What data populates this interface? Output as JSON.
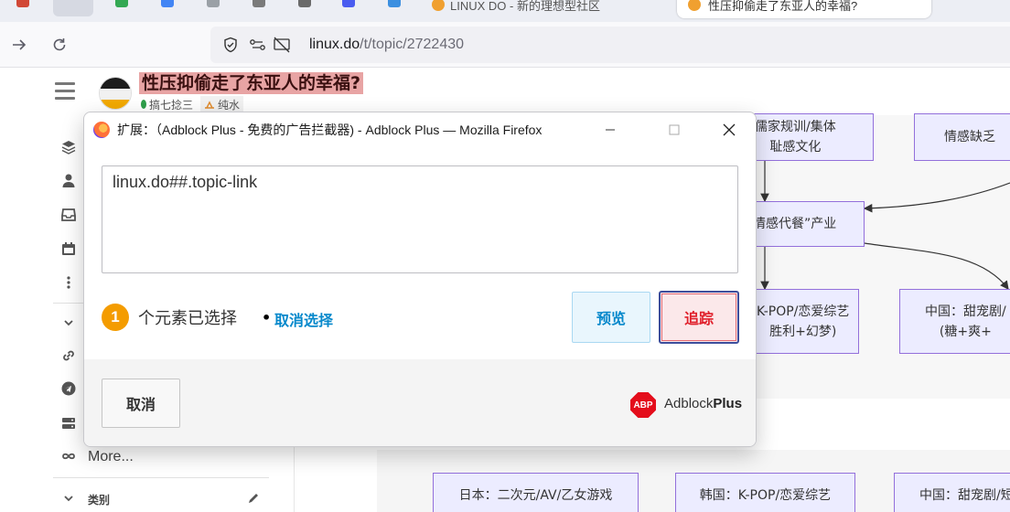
{
  "browser": {
    "tabs": [
      {
        "label": "LINUX DO - 新的理想型社区"
      },
      {
        "label": "性压抑偷走了东亚人的幸福?"
      }
    ],
    "url_host": "linux.do",
    "url_path": "/t/topic/2722430"
  },
  "page": {
    "topic_title": "性压抑偷走了东亚人的幸福?",
    "category": "搞七捻三",
    "tag": "纯水",
    "sidebar": {
      "more_label": "More...",
      "categories_label": "类别"
    },
    "flowchart_boxes": [
      {
        "text": "儒家规训/集体\n耻感文化"
      },
      {
        "text": "情感缺乏"
      },
      {
        "text": "情感代餐”产业"
      },
      {
        "text": "K-POP/恋爱综艺\n胜利+幻梦)"
      },
      {
        "text": "中国：甜宠剧/\n(糖+爽+"
      },
      {
        "text": "日本：二次元/AV/乙女游戏"
      },
      {
        "text": "韩国：K-POP/恋爱综艺"
      },
      {
        "text": "中国：甜宠剧/短"
      }
    ]
  },
  "dialog": {
    "title": "扩展：（Adblock Plus - 免费的广告拦截器) - Adblock Plus — Mozilla Firefox",
    "filter_text": "linux.do##.topic-link",
    "selected_count": "1",
    "selected_text": "个元素已选择",
    "separator": "•",
    "deselect_label": "取消选择",
    "preview_label": "预览",
    "track_label": "追踪",
    "cancel_label": "取消",
    "abp_badge": "ABP",
    "brand_light": "Adblock",
    "brand_bold": "Plus"
  },
  "colors": {
    "title_highlight": "#e8a4a4",
    "abp_red": "#e40d1b",
    "link_blue": "#0688cb",
    "badge_orange": "#f49c00"
  }
}
